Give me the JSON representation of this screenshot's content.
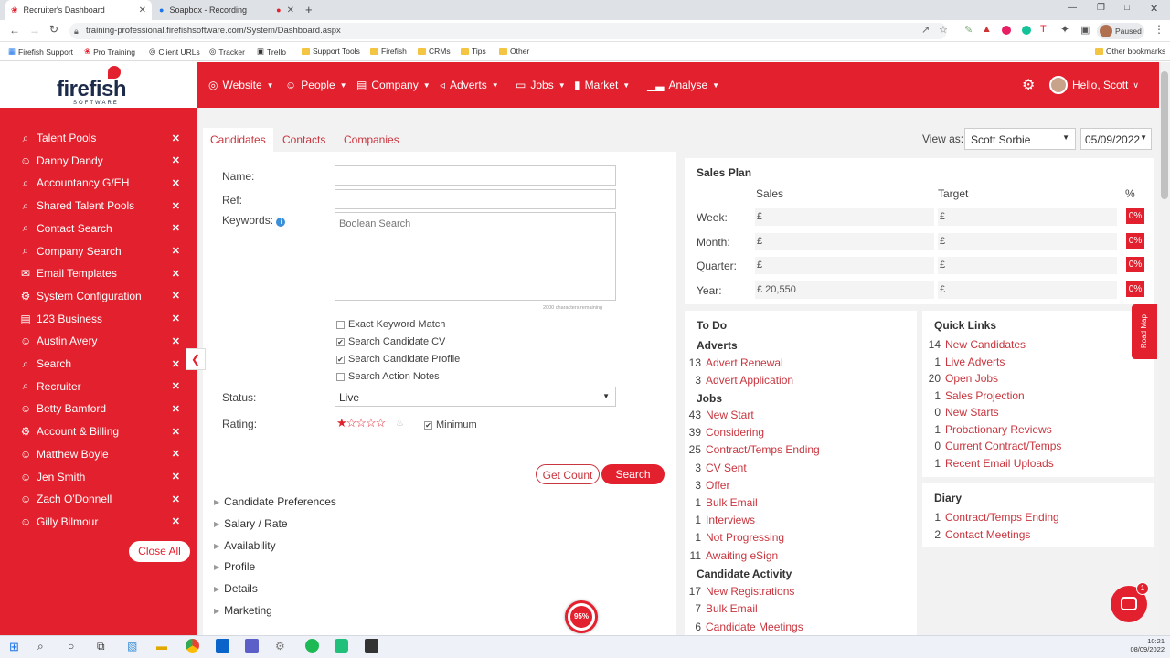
{
  "browser": {
    "tabs": [
      {
        "label": "Recruiter's Dashboard"
      },
      {
        "label": "Soapbox - Recording"
      }
    ],
    "url": "training-professional.firefishsoftware.com/System/Dashboard.aspx",
    "paused_label": "Paused",
    "bookmarks": [
      "Firefish Support",
      "Pro Training",
      "Client URLs",
      "Tracker",
      "Trello",
      "Support Tools",
      "Firefish",
      "CRMs",
      "Tips",
      "Other"
    ],
    "other_bookmarks": "Other bookmarks"
  },
  "logo": {
    "text": "firefish",
    "sub": "SOFTWARE"
  },
  "nav": {
    "items": [
      {
        "label": "Website"
      },
      {
        "label": "People"
      },
      {
        "label": "Company"
      },
      {
        "label": "Adverts"
      },
      {
        "label": "Jobs"
      },
      {
        "label": "Market"
      },
      {
        "label": "Analyse"
      }
    ],
    "user": "Hello, Scott"
  },
  "sidebar": {
    "items": [
      {
        "label": "Talent Pools",
        "icon": "search"
      },
      {
        "label": "Danny Dandy",
        "icon": "person"
      },
      {
        "label": "Accountancy G/EH",
        "icon": "search"
      },
      {
        "label": "Shared Talent Pools",
        "icon": "search"
      },
      {
        "label": "Contact Search",
        "icon": "search"
      },
      {
        "label": "Company Search",
        "icon": "search"
      },
      {
        "label": "Email Templates",
        "icon": "envelope"
      },
      {
        "label": "System Configuration",
        "icon": "gear"
      },
      {
        "label": "123 Business",
        "icon": "building"
      },
      {
        "label": "Austin Avery",
        "icon": "person"
      },
      {
        "label": "Search",
        "icon": "search"
      },
      {
        "label": "Recruiter",
        "icon": "search"
      },
      {
        "label": "Betty Bamford",
        "icon": "person"
      },
      {
        "label": "Account & Billing",
        "icon": "gear"
      },
      {
        "label": "Matthew Boyle",
        "icon": "person"
      },
      {
        "label": "Jen Smith",
        "icon": "person"
      },
      {
        "label": "Zach O'Donnell",
        "icon": "person"
      },
      {
        "label": "Gilly Bilmour",
        "icon": "person"
      }
    ],
    "close_all": "Close All"
  },
  "search": {
    "tabs": [
      "Candidates",
      "Contacts",
      "Companies"
    ],
    "name_label": "Name:",
    "ref_label": "Ref:",
    "keywords_label": "Keywords:",
    "keywords_placeholder": "Boolean Search",
    "chars_remaining": "2000 characters remaining",
    "checkboxes": [
      {
        "label": "Exact Keyword Match",
        "checked": false
      },
      {
        "label": "Search Candidate CV",
        "checked": true
      },
      {
        "label": "Search Candidate Profile",
        "checked": true
      },
      {
        "label": "Search Action Notes",
        "checked": false
      }
    ],
    "status_label": "Status:",
    "status_value": "Live",
    "rating_label": "Rating:",
    "minimum_label": "Minimum",
    "rating_value": 1,
    "get_count": "Get Count",
    "search_btn": "Search",
    "sections": [
      "Candidate Preferences",
      "Salary / Rate",
      "Availability",
      "Profile",
      "Details",
      "Marketing"
    ]
  },
  "view_as": {
    "label": "View as:",
    "user": "Scott Sorbie",
    "date": "05/09/2022"
  },
  "sales_plan": {
    "title": "Sales Plan",
    "col_sales": "Sales",
    "col_target": "Target",
    "col_pct": "%",
    "rows": [
      {
        "label": "Week:",
        "sales": "£",
        "target": "£",
        "pct": "0%"
      },
      {
        "label": "Month:",
        "sales": "£",
        "target": "£",
        "pct": "0%"
      },
      {
        "label": "Quarter:",
        "sales": "£",
        "target": "£",
        "pct": "0%"
      },
      {
        "label": "Year:",
        "sales": "£ 20,550",
        "target": "£",
        "pct": "0%"
      }
    ]
  },
  "todo": {
    "title": "To Do",
    "adverts_head": "Adverts",
    "adverts": [
      {
        "n": "13",
        "t": "Advert Renewal"
      },
      {
        "n": "3",
        "t": "Advert Application"
      }
    ],
    "jobs_head": "Jobs",
    "jobs": [
      {
        "n": "43",
        "t": "New Start"
      },
      {
        "n": "39",
        "t": "Considering"
      },
      {
        "n": "25",
        "t": "Contract/Temps Ending"
      },
      {
        "n": "3",
        "t": "CV Sent"
      },
      {
        "n": "3",
        "t": "Offer"
      },
      {
        "n": "1",
        "t": "Bulk Email"
      },
      {
        "n": "1",
        "t": "Interviews"
      },
      {
        "n": "1",
        "t": "Not Progressing"
      },
      {
        "n": "11",
        "t": "Awaiting eSign"
      }
    ],
    "activity_head": "Candidate Activity",
    "activity": [
      {
        "n": "17",
        "t": "New Registrations"
      },
      {
        "n": "7",
        "t": "Bulk Email"
      },
      {
        "n": "6",
        "t": "Candidate Meetings"
      }
    ]
  },
  "quick_links": {
    "title": "Quick Links",
    "items": [
      {
        "n": "14",
        "t": "New Candidates"
      },
      {
        "n": "1",
        "t": "Live Adverts"
      },
      {
        "n": "20",
        "t": "Open Jobs"
      },
      {
        "n": "1",
        "t": "Sales Projection"
      },
      {
        "n": "0",
        "t": "New Starts"
      },
      {
        "n": "1",
        "t": "Probationary Reviews"
      },
      {
        "n": "0",
        "t": "Current Contract/Temps"
      },
      {
        "n": "1",
        "t": "Recent Email Uploads"
      }
    ]
  },
  "diary": {
    "title": "Diary",
    "items": [
      {
        "n": "1",
        "t": "Contract/Temps Ending"
      },
      {
        "n": "2",
        "t": "Contact Meetings"
      }
    ]
  },
  "road_map": "Road Map",
  "progress_badge": "95%",
  "chat_badge": "1",
  "taskbar": {
    "time": "10:21",
    "date": "08/09/2022"
  }
}
